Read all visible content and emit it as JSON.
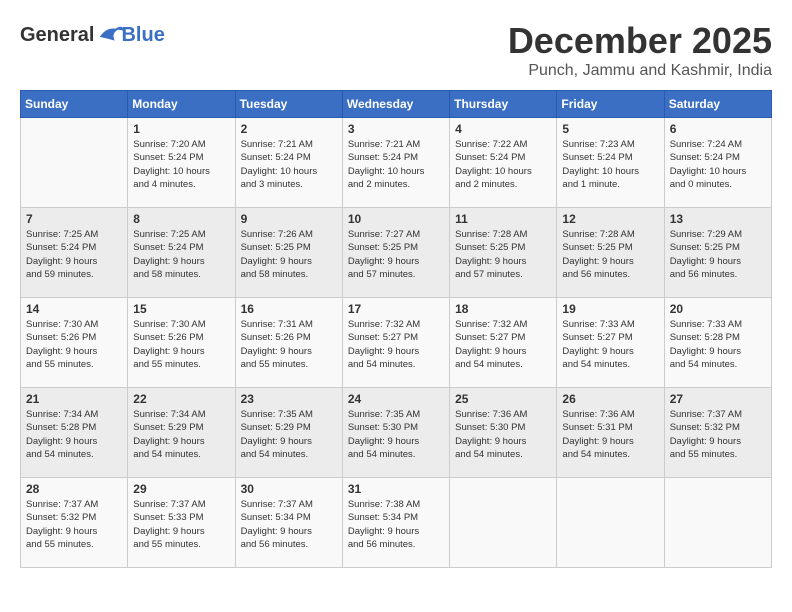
{
  "logo": {
    "text_general": "General",
    "text_blue": "Blue"
  },
  "title": {
    "month": "December 2025",
    "location": "Punch, Jammu and Kashmir, India"
  },
  "days_of_week": [
    "Sunday",
    "Monday",
    "Tuesday",
    "Wednesday",
    "Thursday",
    "Friday",
    "Saturday"
  ],
  "weeks": [
    [
      {
        "day": "",
        "info": ""
      },
      {
        "day": "1",
        "info": "Sunrise: 7:20 AM\nSunset: 5:24 PM\nDaylight: 10 hours\nand 4 minutes."
      },
      {
        "day": "2",
        "info": "Sunrise: 7:21 AM\nSunset: 5:24 PM\nDaylight: 10 hours\nand 3 minutes."
      },
      {
        "day": "3",
        "info": "Sunrise: 7:21 AM\nSunset: 5:24 PM\nDaylight: 10 hours\nand 2 minutes."
      },
      {
        "day": "4",
        "info": "Sunrise: 7:22 AM\nSunset: 5:24 PM\nDaylight: 10 hours\nand 2 minutes."
      },
      {
        "day": "5",
        "info": "Sunrise: 7:23 AM\nSunset: 5:24 PM\nDaylight: 10 hours\nand 1 minute."
      },
      {
        "day": "6",
        "info": "Sunrise: 7:24 AM\nSunset: 5:24 PM\nDaylight: 10 hours\nand 0 minutes."
      }
    ],
    [
      {
        "day": "7",
        "info": "Sunrise: 7:25 AM\nSunset: 5:24 PM\nDaylight: 9 hours\nand 59 minutes."
      },
      {
        "day": "8",
        "info": "Sunrise: 7:25 AM\nSunset: 5:24 PM\nDaylight: 9 hours\nand 58 minutes."
      },
      {
        "day": "9",
        "info": "Sunrise: 7:26 AM\nSunset: 5:25 PM\nDaylight: 9 hours\nand 58 minutes."
      },
      {
        "day": "10",
        "info": "Sunrise: 7:27 AM\nSunset: 5:25 PM\nDaylight: 9 hours\nand 57 minutes."
      },
      {
        "day": "11",
        "info": "Sunrise: 7:28 AM\nSunset: 5:25 PM\nDaylight: 9 hours\nand 57 minutes."
      },
      {
        "day": "12",
        "info": "Sunrise: 7:28 AM\nSunset: 5:25 PM\nDaylight: 9 hours\nand 56 minutes."
      },
      {
        "day": "13",
        "info": "Sunrise: 7:29 AM\nSunset: 5:25 PM\nDaylight: 9 hours\nand 56 minutes."
      }
    ],
    [
      {
        "day": "14",
        "info": "Sunrise: 7:30 AM\nSunset: 5:26 PM\nDaylight: 9 hours\nand 55 minutes."
      },
      {
        "day": "15",
        "info": "Sunrise: 7:30 AM\nSunset: 5:26 PM\nDaylight: 9 hours\nand 55 minutes."
      },
      {
        "day": "16",
        "info": "Sunrise: 7:31 AM\nSunset: 5:26 PM\nDaylight: 9 hours\nand 55 minutes."
      },
      {
        "day": "17",
        "info": "Sunrise: 7:32 AM\nSunset: 5:27 PM\nDaylight: 9 hours\nand 54 minutes."
      },
      {
        "day": "18",
        "info": "Sunrise: 7:32 AM\nSunset: 5:27 PM\nDaylight: 9 hours\nand 54 minutes."
      },
      {
        "day": "19",
        "info": "Sunrise: 7:33 AM\nSunset: 5:27 PM\nDaylight: 9 hours\nand 54 minutes."
      },
      {
        "day": "20",
        "info": "Sunrise: 7:33 AM\nSunset: 5:28 PM\nDaylight: 9 hours\nand 54 minutes."
      }
    ],
    [
      {
        "day": "21",
        "info": "Sunrise: 7:34 AM\nSunset: 5:28 PM\nDaylight: 9 hours\nand 54 minutes."
      },
      {
        "day": "22",
        "info": "Sunrise: 7:34 AM\nSunset: 5:29 PM\nDaylight: 9 hours\nand 54 minutes."
      },
      {
        "day": "23",
        "info": "Sunrise: 7:35 AM\nSunset: 5:29 PM\nDaylight: 9 hours\nand 54 minutes."
      },
      {
        "day": "24",
        "info": "Sunrise: 7:35 AM\nSunset: 5:30 PM\nDaylight: 9 hours\nand 54 minutes."
      },
      {
        "day": "25",
        "info": "Sunrise: 7:36 AM\nSunset: 5:30 PM\nDaylight: 9 hours\nand 54 minutes."
      },
      {
        "day": "26",
        "info": "Sunrise: 7:36 AM\nSunset: 5:31 PM\nDaylight: 9 hours\nand 54 minutes."
      },
      {
        "day": "27",
        "info": "Sunrise: 7:37 AM\nSunset: 5:32 PM\nDaylight: 9 hours\nand 55 minutes."
      }
    ],
    [
      {
        "day": "28",
        "info": "Sunrise: 7:37 AM\nSunset: 5:32 PM\nDaylight: 9 hours\nand 55 minutes."
      },
      {
        "day": "29",
        "info": "Sunrise: 7:37 AM\nSunset: 5:33 PM\nDaylight: 9 hours\nand 55 minutes."
      },
      {
        "day": "30",
        "info": "Sunrise: 7:37 AM\nSunset: 5:34 PM\nDaylight: 9 hours\nand 56 minutes."
      },
      {
        "day": "31",
        "info": "Sunrise: 7:38 AM\nSunset: 5:34 PM\nDaylight: 9 hours\nand 56 minutes."
      },
      {
        "day": "",
        "info": ""
      },
      {
        "day": "",
        "info": ""
      },
      {
        "day": "",
        "info": ""
      }
    ]
  ]
}
